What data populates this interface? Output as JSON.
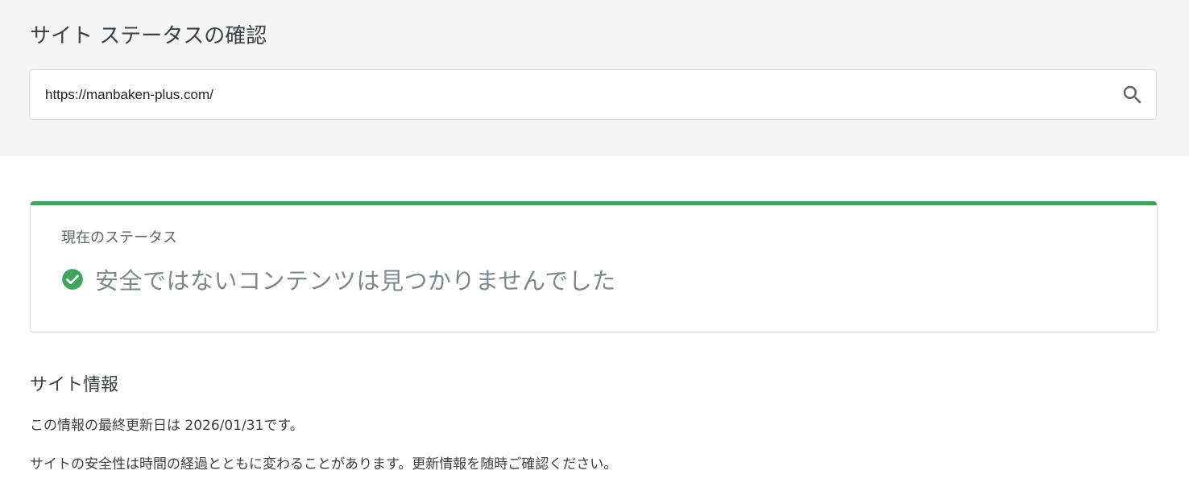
{
  "header": {
    "title": "サイト ステータスの確認"
  },
  "search": {
    "value": "https://manbaken-plus.com/",
    "button_icon": "search-icon"
  },
  "status": {
    "label": "現在のステータス",
    "message": "安全ではないコンテンツは見つかりませんでした",
    "icon": "check-circle-icon",
    "color": "#3fa55b"
  },
  "site_info": {
    "title": "サイト情報",
    "last_updated_prefix": "この情報の最終更新日は ",
    "last_updated_date": "2026/01/31",
    "last_updated_suffix": "です。",
    "note": "サイトの安全性は時間の経過とともに変わることがあります。更新情報を随時ご確認ください。"
  }
}
